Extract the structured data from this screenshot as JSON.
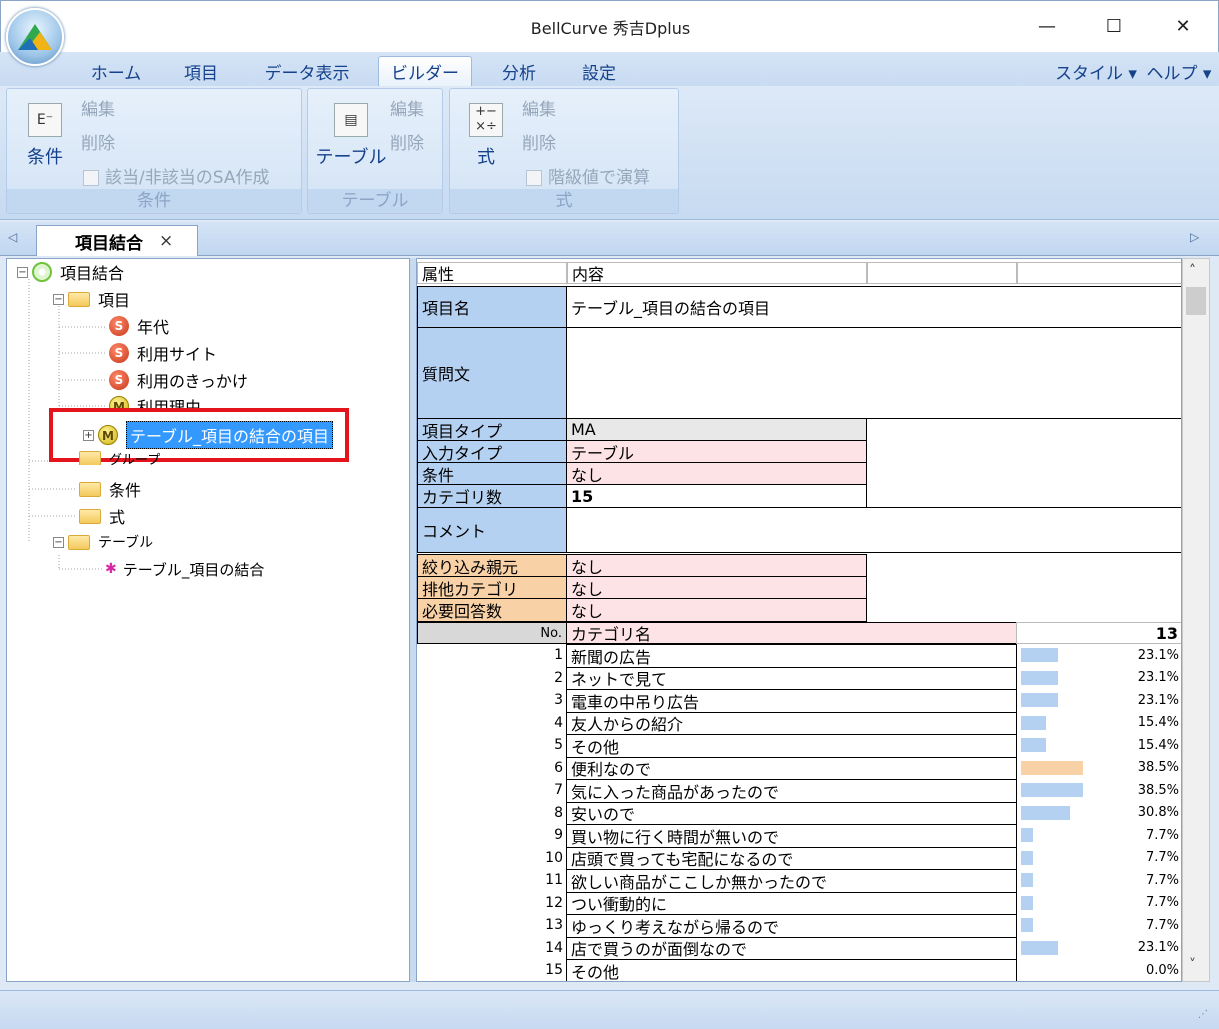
{
  "window": {
    "title": "BellCurve 秀吉Dplus",
    "minimize": "—",
    "maximize": "☐",
    "close": "✕"
  },
  "ribbon": {
    "tabs": [
      "ホーム",
      "項目",
      "データ表示",
      "ビルダー",
      "分析",
      "設定"
    ],
    "active_tab": "ビルダー",
    "right": {
      "style": "スタイル ▾",
      "help": "ヘルプ ▾"
    },
    "groups": {
      "condition": {
        "big": "条件",
        "edit": "編集",
        "delete": "削除",
        "checkbox": "該当/非該当のSA作成",
        "label": "条件"
      },
      "table": {
        "big": "テーブル",
        "edit": "編集",
        "delete": "削除",
        "label": "テーブル"
      },
      "formula": {
        "big": "式",
        "edit": "編集",
        "delete": "削除",
        "checkbox": "階級値で演算",
        "label": "式"
      }
    }
  },
  "doc_tab": {
    "label": "項目結合",
    "close": "×",
    "left_arrow": "◁",
    "right_arrow": "▷"
  },
  "tree": {
    "root": "項目結合",
    "items_folder": "項目",
    "items": [
      {
        "badge": "S",
        "label": "年代"
      },
      {
        "badge": "S",
        "label": "利用サイト"
      },
      {
        "badge": "S",
        "label": "利用のきっかけ"
      },
      {
        "badge": "M",
        "label": "利用理由"
      },
      {
        "badge": "M",
        "label": "テーブル_項目の結合の項目"
      }
    ],
    "group_folder": "グループ",
    "condition_folder": "条件",
    "formula_folder": "式",
    "table_folder": "テーブル",
    "table_item": "テーブル_項目の結合"
  },
  "grid": {
    "header": {
      "attr": "属性",
      "content": "内容"
    },
    "item_name": {
      "label": "項目名",
      "value": "テーブル_項目の結合の項目"
    },
    "question": {
      "label": "質問文",
      "value": ""
    },
    "item_type": {
      "label": "項目タイプ",
      "value": "MA"
    },
    "input_type": {
      "label": "入力タイプ",
      "value": "テーブル"
    },
    "condition": {
      "label": "条件",
      "value": "なし"
    },
    "category_count": {
      "label": "カテゴリ数",
      "value": "15"
    },
    "comment": {
      "label": "コメント",
      "value": ""
    },
    "filter_parent": {
      "label": "絞り込み親元",
      "value": "なし"
    },
    "exclusive": {
      "label": "排他カテゴリ",
      "value": "なし"
    },
    "required": {
      "label": "必要回答数",
      "value": "なし"
    },
    "cat_header": {
      "no": "No.",
      "name": "カテゴリ名",
      "n": "13"
    },
    "categories": [
      {
        "no": "1",
        "name": "新聞の広告",
        "pct": "23.1%",
        "v": 23.1
      },
      {
        "no": "2",
        "name": "ネットで見て",
        "pct": "23.1%",
        "v": 23.1
      },
      {
        "no": "3",
        "name": "電車の中吊り広告",
        "pct": "23.1%",
        "v": 23.1
      },
      {
        "no": "4",
        "name": "友人からの紹介",
        "pct": "15.4%",
        "v": 15.4
      },
      {
        "no": "5",
        "name": "その他",
        "pct": "15.4%",
        "v": 15.4
      },
      {
        "no": "6",
        "name": "便利なので",
        "pct": "38.5%",
        "v": 38.5
      },
      {
        "no": "7",
        "name": "気に入った商品があったので",
        "pct": "38.5%",
        "v": 38.5
      },
      {
        "no": "8",
        "name": "安いので",
        "pct": "30.8%",
        "v": 30.8
      },
      {
        "no": "9",
        "name": "買い物に行く時間が無いので",
        "pct": "7.7%",
        "v": 7.7
      },
      {
        "no": "10",
        "name": "店頭で買っても宅配になるので",
        "pct": "7.7%",
        "v": 7.7
      },
      {
        "no": "11",
        "name": "欲しい商品がここしか無かったので",
        "pct": "7.7%",
        "v": 7.7
      },
      {
        "no": "12",
        "name": "つい衝動的に",
        "pct": "7.7%",
        "v": 7.7
      },
      {
        "no": "13",
        "name": "ゆっくり考えながら帰るので",
        "pct": "7.7%",
        "v": 7.7
      },
      {
        "no": "14",
        "name": "店で買うのが面倒なので",
        "pct": "23.1%",
        "v": 23.1
      },
      {
        "no": "15",
        "name": "その他",
        "pct": "0.0%",
        "v": 0.0
      }
    ],
    "bar_color": "#b5d1f1",
    "highlight_bar_color": "#f8d1a6",
    "highlight_row": "6"
  },
  "scroll": {
    "up": "˄",
    "down": "˅"
  }
}
